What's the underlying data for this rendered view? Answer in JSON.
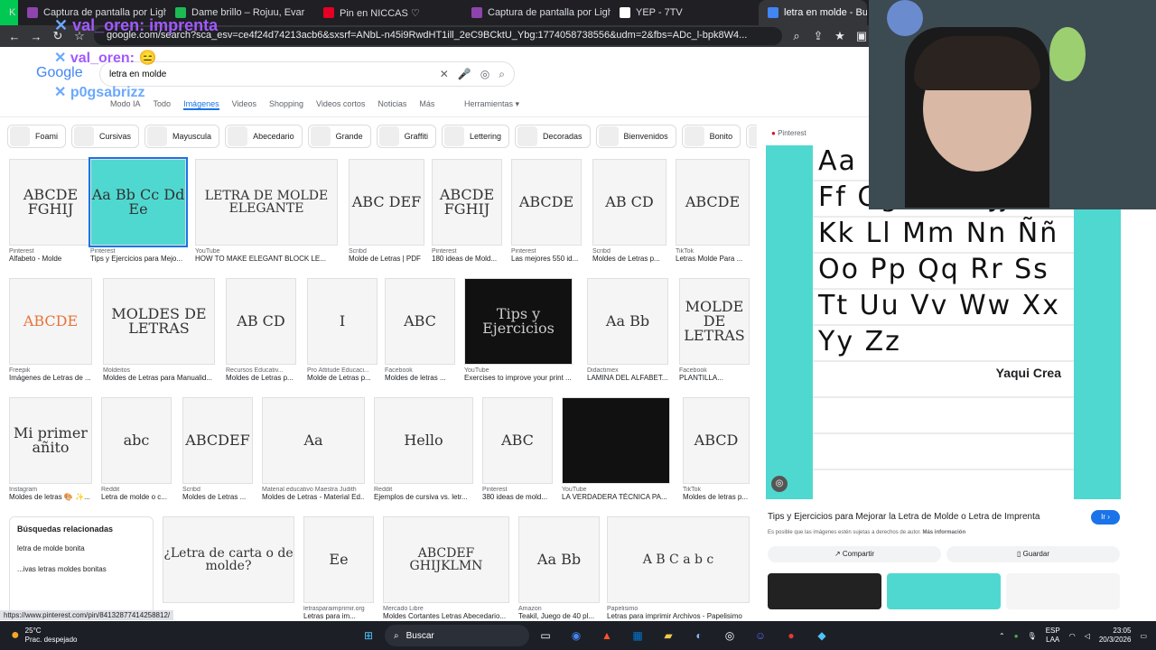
{
  "tabs": [
    {
      "label": "Captura de pantalla por Lightshot",
      "color": "#8e44ad"
    },
    {
      "label": "Dame brillo – Rojuu, Evar",
      "color": "#1db954"
    },
    {
      "label": "Pin en NICCAS ♡",
      "color": "#e60023"
    },
    {
      "label": "Captura de pantalla por Lightshot",
      "color": "#8e44ad"
    },
    {
      "label": "YEP - 7TV",
      "color": "#ffffff"
    },
    {
      "label": "letra en molde - Buscar co",
      "color": "#4285f4",
      "active": true
    }
  ],
  "address": {
    "url": "google.com/search?sca_esv=ce4f24d74213acb6&sxsrf=ANbL-n45i9RwdHT1ill_2eC9BCktU_Ybg:1774058738556&udm=2&fbs=ADc_l-bpk8W4..."
  },
  "search": {
    "logo": "Google",
    "query": "letra en molde"
  },
  "search_tabs": [
    "Modo IA",
    "Todo",
    "Imágenes",
    "Videos",
    "Shopping",
    "Videos cortos",
    "Noticias",
    "Más"
  ],
  "tools_label": "Herramientas",
  "chips": [
    "Foami",
    "Cursivas",
    "Mayuscula",
    "Abecedario",
    "Grande",
    "Graffiti",
    "Lettering",
    "Decoradas",
    "Bienvenidos",
    "Bonito",
    "Individual"
  ],
  "results": [
    {
      "src": "Pinterest",
      "caption": "Alfabeto - Molde",
      "glyph": "ABCDE FGHIJ"
    },
    {
      "src": "Pinterest",
      "caption": "Tips y Ejercicios para Mejo...",
      "glyph": "Aa Bb Cc Dd Ee"
    },
    {
      "src": "YouTube",
      "caption": "HOW TO MAKE ELEGANT BLOCK LE...",
      "glyph": "LETRA DE MOLDE ELEGANTE"
    },
    {
      "src": "Scribd",
      "caption": "Molde de Letras | PDF",
      "glyph": "ABC DEF"
    },
    {
      "src": "Pinterest",
      "caption": "180 ideas de Mold...",
      "glyph": "ABCDE FGHIJ"
    },
    {
      "src": "Pinterest",
      "caption": "Las mejores 550 id...",
      "glyph": "ABCDE"
    },
    {
      "src": "Scribd",
      "caption": "Moldes de Letras p...",
      "glyph": "AB CD"
    },
    {
      "src": "TikTok",
      "caption": "Letras Molde Para ...",
      "glyph": "ABCDE"
    },
    {
      "src": "Freepik",
      "caption": "Imágenes de Letras de ...",
      "glyph": "ABCDE"
    },
    {
      "src": "Moldeitos",
      "caption": "Moldes de Letras para Manualid...",
      "glyph": "MOLDES DE LETRAS"
    },
    {
      "src": "Recursos Educativ...",
      "caption": "Moldes de Letras p...",
      "glyph": "AB CD"
    },
    {
      "src": "Pro Attitude Educaci...",
      "caption": "Molde de Letras p...",
      "glyph": "I"
    },
    {
      "src": "Facebook",
      "caption": "Moldes de letras ...",
      "glyph": "ABC"
    },
    {
      "src": "YouTube",
      "caption": "Exercises to improve your print ...",
      "glyph": "Tips y Ejercicios"
    },
    {
      "src": "Didactimex",
      "caption": "LAMINA DEL ALFABET...",
      "glyph": "Aa Bb"
    },
    {
      "src": "Facebook",
      "caption": "PLANTILLA...",
      "glyph": "MOLDE DE LETRAS"
    },
    {
      "src": "Instagram",
      "caption": "Moldes de letras 🎨 ✨...",
      "glyph": "Mi primer añito"
    },
    {
      "src": "Reddit",
      "caption": "Letra de molde o c...",
      "glyph": "abc"
    },
    {
      "src": "Scribd",
      "caption": "Moldes de Letras ...",
      "glyph": "ABCDEF"
    },
    {
      "src": "Material educativo Maestra Judith",
      "caption": "Moldes de Letras - Material Ed...",
      "glyph": "Aa"
    },
    {
      "src": "Reddit",
      "caption": "Ejemplos de cursiva vs. letr...",
      "glyph": "Hello"
    },
    {
      "src": "Pinterest",
      "caption": "380 ideas de mold...",
      "glyph": "ABC"
    },
    {
      "src": "YouTube",
      "caption": "LA VERDADERA TÉCNICA PA...",
      "glyph": ""
    },
    {
      "src": "TikTok",
      "caption": "Moldes de letras p...",
      "glyph": "ABCD"
    },
    {
      "src": "",
      "caption": "",
      "glyph": "¿Letra de carta o de molde?"
    },
    {
      "src": "letrasparaimprimir.org",
      "caption": "Letras para im...",
      "glyph": "Ee"
    },
    {
      "src": "Mercado Libre",
      "caption": "Moldes Cortantes Letras Abecedario...",
      "glyph": "ABCDEF GHIJKLMN"
    },
    {
      "src": "Amazon",
      "caption": "Teakil, Juego de 40 pl...",
      "glyph": "Aa Bb"
    },
    {
      "src": "Papelisimo",
      "caption": "Letras para imprimir Archivos - Papelisimo",
      "glyph": "A B C a b c"
    }
  ],
  "related": {
    "title": "Búsquedas relacionadas",
    "items": [
      "letra de molde bonita",
      "...ivas letras moldes bonitas"
    ]
  },
  "panel": {
    "source": "Pinterest",
    "title": "Tips y Ejercicios para Mejorar la Letra de Molde o Letra de Imprenta",
    "go_label": "Ir",
    "copyright": "Es posible que las imágenes estén sujetas a derechos de autor.",
    "more_info": "Más información",
    "share": "Compartir",
    "save": "Guardar",
    "brand": "Yaqui Crea",
    "letter_rows": [
      "Aa",
      "Ff  Gg  Hh  Ii  Jj",
      "Kk  Ll  Mm  Nn  Ññ",
      "Oo  Pp  Qq  Rr  Ss",
      "Tt  Uu  Vv  Ww  Xx",
      "Yy  Zz"
    ]
  },
  "status_url": "https://www.pinterest.com/pin/84132877414258812/",
  "chat_overlays": [
    {
      "text": "val_oren: imprenta",
      "color": "#a259ff"
    },
    {
      "text": "val_oren:",
      "color": "#a259ff"
    },
    {
      "text": "p0gsabrizz",
      "color": "#6aa8ff"
    }
  ],
  "taskbar": {
    "weather_temp": "25°C",
    "weather_desc": "Prac. despejado",
    "search_label": "Buscar",
    "lang": "ESP",
    "lang2": "LAA",
    "time": "23:05",
    "date": "20/3/2026"
  }
}
